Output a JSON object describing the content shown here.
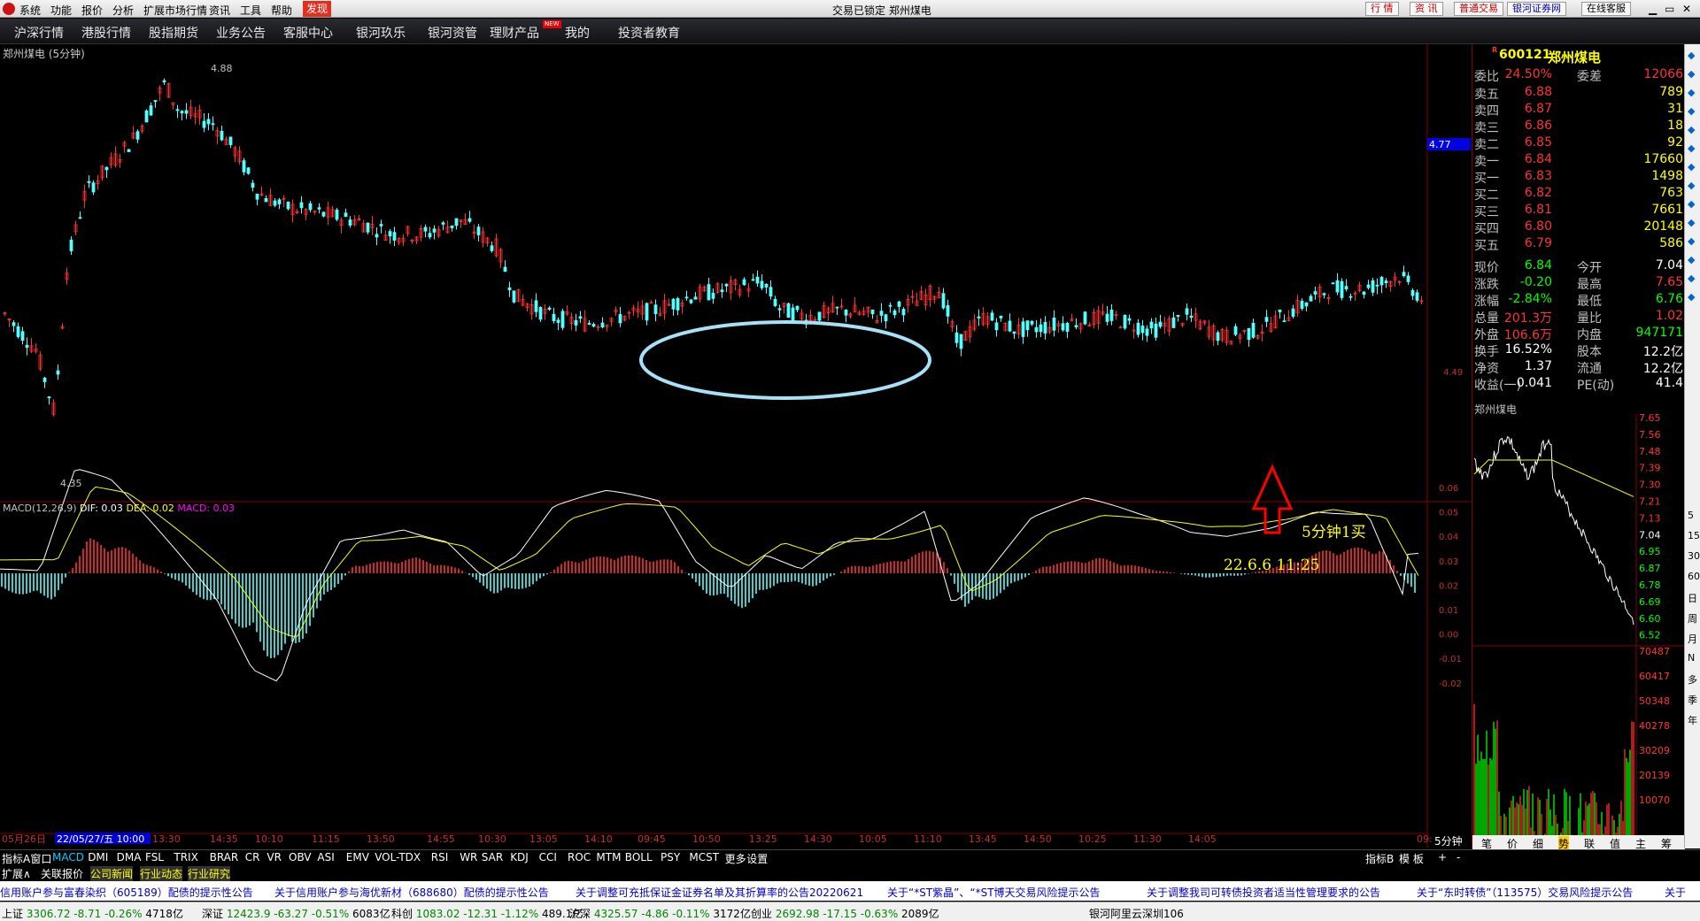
{
  "menu": {
    "items": [
      "系统",
      "功能",
      "报价",
      "分析",
      "扩展市场行情",
      "资讯",
      "工具",
      "帮助"
    ],
    "discover": "发现",
    "center": "交易已锁定  郑州煤电",
    "right_buttons": [
      "行 情",
      "资 讯",
      "普通交易",
      "银河证券网",
      "在线客服"
    ]
  },
  "nav": {
    "items": [
      "沪深行情",
      "港股行情",
      "股指期货",
      "业务公告",
      "客服中心",
      "银河玖乐",
      "银河资管",
      "理财产品",
      "我的",
      "投资者教育"
    ],
    "new_badge": "NEW"
  },
  "stock": {
    "title": "郑州煤电 (5分钟)",
    "high_label": "4.88",
    "low_label": "4.35",
    "price_tag": "4.77",
    "price_right": "4.49"
  },
  "annotation": {
    "arrow_text": "5分钟1买",
    "date_text": "22.6.6  11:25"
  },
  "macd": {
    "name": "MACD(12,26,9)",
    "dif": "DIF: 0.03",
    "dea": "DEA: 0.02",
    "macd": "MACD: 0.03",
    "yticks": [
      "0.06",
      "0.05",
      "0.04",
      "0.03",
      "0.02",
      "0.01",
      "0.00",
      "-0.01",
      "-0.02"
    ]
  },
  "time_axis": {
    "labels": [
      "05月26日",
      "22/05/27/五 10:00",
      "13:30",
      "14:35",
      "10:10",
      "11:15",
      "13:50",
      "14:55",
      "10:30",
      "13:05",
      "14:10",
      "09:45",
      "10:50",
      "13:25",
      "14:30",
      "10:05",
      "11:10",
      "13:45",
      "14:50",
      "10:25",
      "11:30",
      "14:05",
      "09:"
    ],
    "period": "5分钟"
  },
  "quote": {
    "code_badge": "R",
    "code": "600121",
    "name": "郑州煤电",
    "wb": {
      "l": "委比",
      "v": "24.50%",
      "l2": "委差",
      "v2": "12066"
    },
    "asks": [
      [
        "卖五",
        "6.88",
        "789"
      ],
      [
        "卖四",
        "6.87",
        "31"
      ],
      [
        "卖三",
        "6.86",
        "18"
      ],
      [
        "卖二",
        "6.85",
        "92"
      ],
      [
        "卖一",
        "6.84",
        "17660"
      ]
    ],
    "bids": [
      [
        "买一",
        "6.83",
        "1498"
      ],
      [
        "买二",
        "6.82",
        "763"
      ],
      [
        "买三",
        "6.81",
        "7661"
      ],
      [
        "买四",
        "6.80",
        "20148"
      ],
      [
        "买五",
        "6.79",
        "586"
      ]
    ],
    "stats": [
      [
        "现价",
        "6.84",
        "今开",
        "7.04"
      ],
      [
        "涨跌",
        "-0.20",
        "最高",
        "7.65"
      ],
      [
        "涨幅",
        "-2.84%",
        "最低",
        "6.76"
      ],
      [
        "总量",
        "201.3万",
        "量比",
        "1.02"
      ],
      [
        "外盘",
        "106.6万",
        "内盘",
        "947171"
      ],
      [
        "换手",
        "16.52%",
        "股本",
        "12.2亿"
      ],
      [
        "净资",
        "1.37",
        "流通",
        "12.2亿"
      ],
      [
        "收益(一)",
        "0.041",
        "PE(动)",
        "41.4"
      ]
    ]
  },
  "mini": {
    "title": "郑州煤电",
    "price_ticks": [
      "7.65",
      "7.56",
      "7.48",
      "7.39",
      "7.30",
      "7.21",
      "7.13",
      "7.04",
      "6.95",
      "6.87",
      "6.78",
      "6.69",
      "6.60",
      "6.52"
    ],
    "vol_ticks": [
      "70487",
      "60417",
      "50348",
      "40278",
      "30209",
      "20139",
      "10070"
    ],
    "tabs": [
      "笔",
      "价",
      "细",
      "势",
      "联",
      "值",
      "主",
      "筹"
    ]
  },
  "side_tools": [
    "5",
    "15",
    "30",
    "60",
    "日",
    "周",
    "月",
    "N",
    "多",
    "季",
    "年"
  ],
  "indicator_tabs": [
    "指标A",
    "窗口",
    "MACD",
    "DMI",
    "DMA",
    "FSL",
    "TRIX",
    "BRAR",
    "CR",
    "VR",
    "OBV",
    "ASI",
    "EMV",
    "VOL-TDX",
    "RSI",
    "WR",
    "SAR",
    "KDJ",
    "CCI",
    "ROC",
    "MTM",
    "BOLL",
    "PSY",
    "MCST",
    "更多",
    "设置"
  ],
  "right_tabs": [
    "指标B",
    "模 板",
    "+",
    "-"
  ],
  "ext_tabs": [
    "扩展∧",
    "关联报价",
    "公司新闻",
    "行业动态",
    "行业研究"
  ],
  "news": [
    "信用账户参与富春染织（605189）配债的提示性公告",
    "关于信用账户参与海优新材（688680）配债的提示性公告",
    "关于调整可充抵保证金证券名单及其折算率的公告20220621",
    "关于“*ST紫晶”、“*ST博天交易风险提示公告",
    "关于调整我司可转债投资者适当性管理要求的公告",
    "关于“东时转债”（113575）交易风险提示公告",
    "关于"
  ],
  "status": [
    {
      "name": "上证",
      "v": "3306.72",
      "c": "-8.71",
      "p": "-0.26%",
      "a": "4718亿"
    },
    {
      "name": "深证",
      "v": "12423.9",
      "c": "-63.27",
      "p": "-0.51%",
      "a": "6083亿"
    },
    {
      "name": "科创",
      "v": "1083.02",
      "c": "-12.31",
      "p": "-1.12%",
      "a": "489.1亿"
    },
    {
      "name": "沪深",
      "v": "4325.57",
      "c": "-4.86",
      "p": "-0.11%",
      "a": "3172亿"
    },
    {
      "name": "创业",
      "v": "2692.98",
      "c": "-17.15",
      "p": "-0.63%",
      "a": "2089亿"
    }
  ],
  "server": "银河阿里云深圳106",
  "colors": {
    "up": "#ff3232",
    "down": "#54ffff",
    "dif": "#ffffff",
    "dea": "#ffff00",
    "ellipse": "#a8e0f8",
    "arrow": "#ff0000",
    "annotation": "#ffff00"
  }
}
